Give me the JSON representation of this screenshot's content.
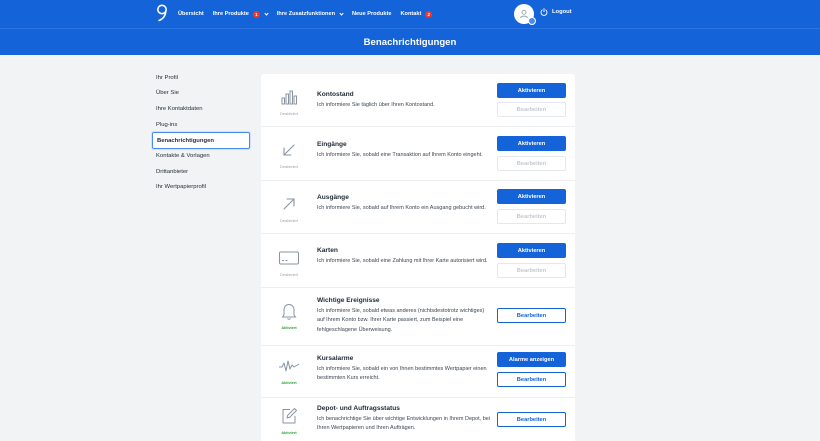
{
  "nav": {
    "items": [
      {
        "label": "Übersicht"
      },
      {
        "label": "Ihre Produkte",
        "badge": "1",
        "dropdown": true
      },
      {
        "label": "Ihre Zusatzfunktionen",
        "dropdown": true
      },
      {
        "label": "Neue Produkte"
      },
      {
        "label": "Kontakt",
        "badge": "2"
      }
    ],
    "logout": "Logout"
  },
  "page_title": "Benachrichtigungen",
  "sidebar": {
    "items": [
      {
        "label": "Ihr Profil"
      },
      {
        "label": "Über Sie"
      },
      {
        "label": "Ihre Kontaktdaten"
      },
      {
        "label": "Plug-ins"
      },
      {
        "label": "Benachrichtigungen",
        "active": true
      },
      {
        "label": "Kontakte & Vorlagen"
      },
      {
        "label": "Drittanbieter"
      },
      {
        "label": "Ihr Wertpapierprofil"
      }
    ]
  },
  "notifications": [
    {
      "title": "Kontostand",
      "desc": "Ich informiere Sie täglich über Ihren Kontostand.",
      "status": "Deaktiviert",
      "icon": "bar-chart-icon",
      "primary": "Aktivieren",
      "secondary": "Bearbeiten",
      "secondary_disabled": true
    },
    {
      "title": "Eingänge",
      "desc": "Ich informiere Sie, sobald eine Transaktion auf Ihrem Konto eingeht.",
      "status": "Deaktiviert",
      "icon": "arrow-down-left-icon",
      "primary": "Aktivieren",
      "secondary": "Bearbeiten",
      "secondary_disabled": true
    },
    {
      "title": "Ausgänge",
      "desc": "Ich informiere Sie, sobald auf Ihrem Konto ein Ausgang gebucht wird.",
      "status": "Deaktiviert",
      "icon": "arrow-up-right-icon",
      "primary": "Aktivieren",
      "secondary": "Bearbeiten",
      "secondary_disabled": true
    },
    {
      "title": "Karten",
      "desc": "Ich informiere Sie, sobald eine Zahlung mit Ihrer Karte autorisiert wird.",
      "status": "Deaktiviert",
      "icon": "card-icon",
      "primary": "Aktivieren",
      "secondary": "Bearbeiten",
      "secondary_disabled": true
    },
    {
      "title": "Wichtige Ereignisse",
      "desc": "Ich informiere Sie, sobald etwas anderes (nichtsdestotrotz wichtiges) auf Ihrem Konto bzw. Ihrer Karte passiert, zum Beispiel eine fehlgeschlagene Überweisung.",
      "status": "Aktiviert",
      "icon": "bell-icon",
      "primary": "",
      "secondary": "Bearbeiten",
      "secondary_disabled": false
    },
    {
      "title": "Kursalarme",
      "desc": "Ich informiere Sie, sobald ein von Ihnen bestimmtes Wertpapier einen bestimmten Kurs erreicht.",
      "status": "Aktiviert",
      "icon": "pulse-icon",
      "primary": "Alarme anzeigen",
      "secondary": "Bearbeiten",
      "secondary_disabled": false
    },
    {
      "title": "Depot- und Auftragsstatus",
      "desc": "Ich benachrichtige Sie über wichtige Entwicklungen in Ihrem Depot, bei Ihren Wertpapieren und Ihren Aufträgen.",
      "status": "Aktiviert",
      "icon": "edit-icon",
      "primary": "",
      "secondary": "Bearbeiten",
      "secondary_disabled": false
    }
  ],
  "colors": {
    "brand": "#1463d9",
    "active_status": "#2e9e3a",
    "badge": "#e53935"
  }
}
